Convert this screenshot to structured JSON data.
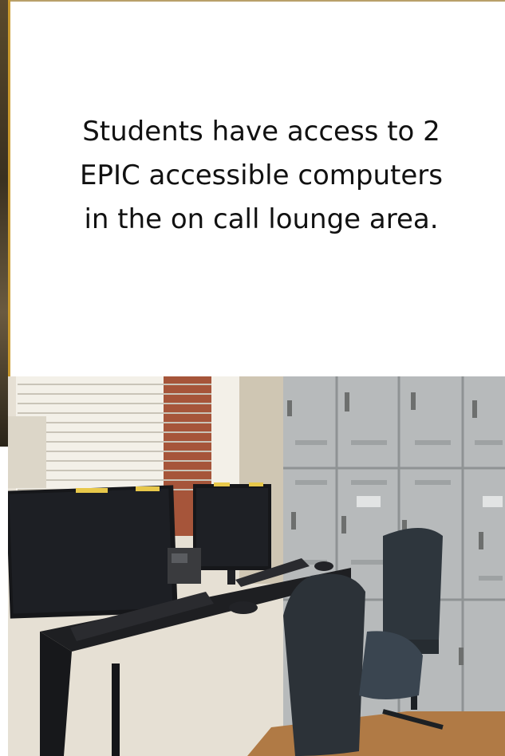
{
  "caption": {
    "line1": "Students have access to 2",
    "line2": "EPIC accessible computers",
    "line3": "in the on call lounge area."
  },
  "photo": {
    "subject": "computer-workstation-photo",
    "colors": {
      "wall": "#e8e2d6",
      "locker": "#b9bcbd",
      "desk": "#1e1f22",
      "monitor": "#16171a",
      "chair": "#2c3238",
      "floor": "#b07a45",
      "window": "#f2efe6",
      "brick": "#a6553a"
    }
  }
}
